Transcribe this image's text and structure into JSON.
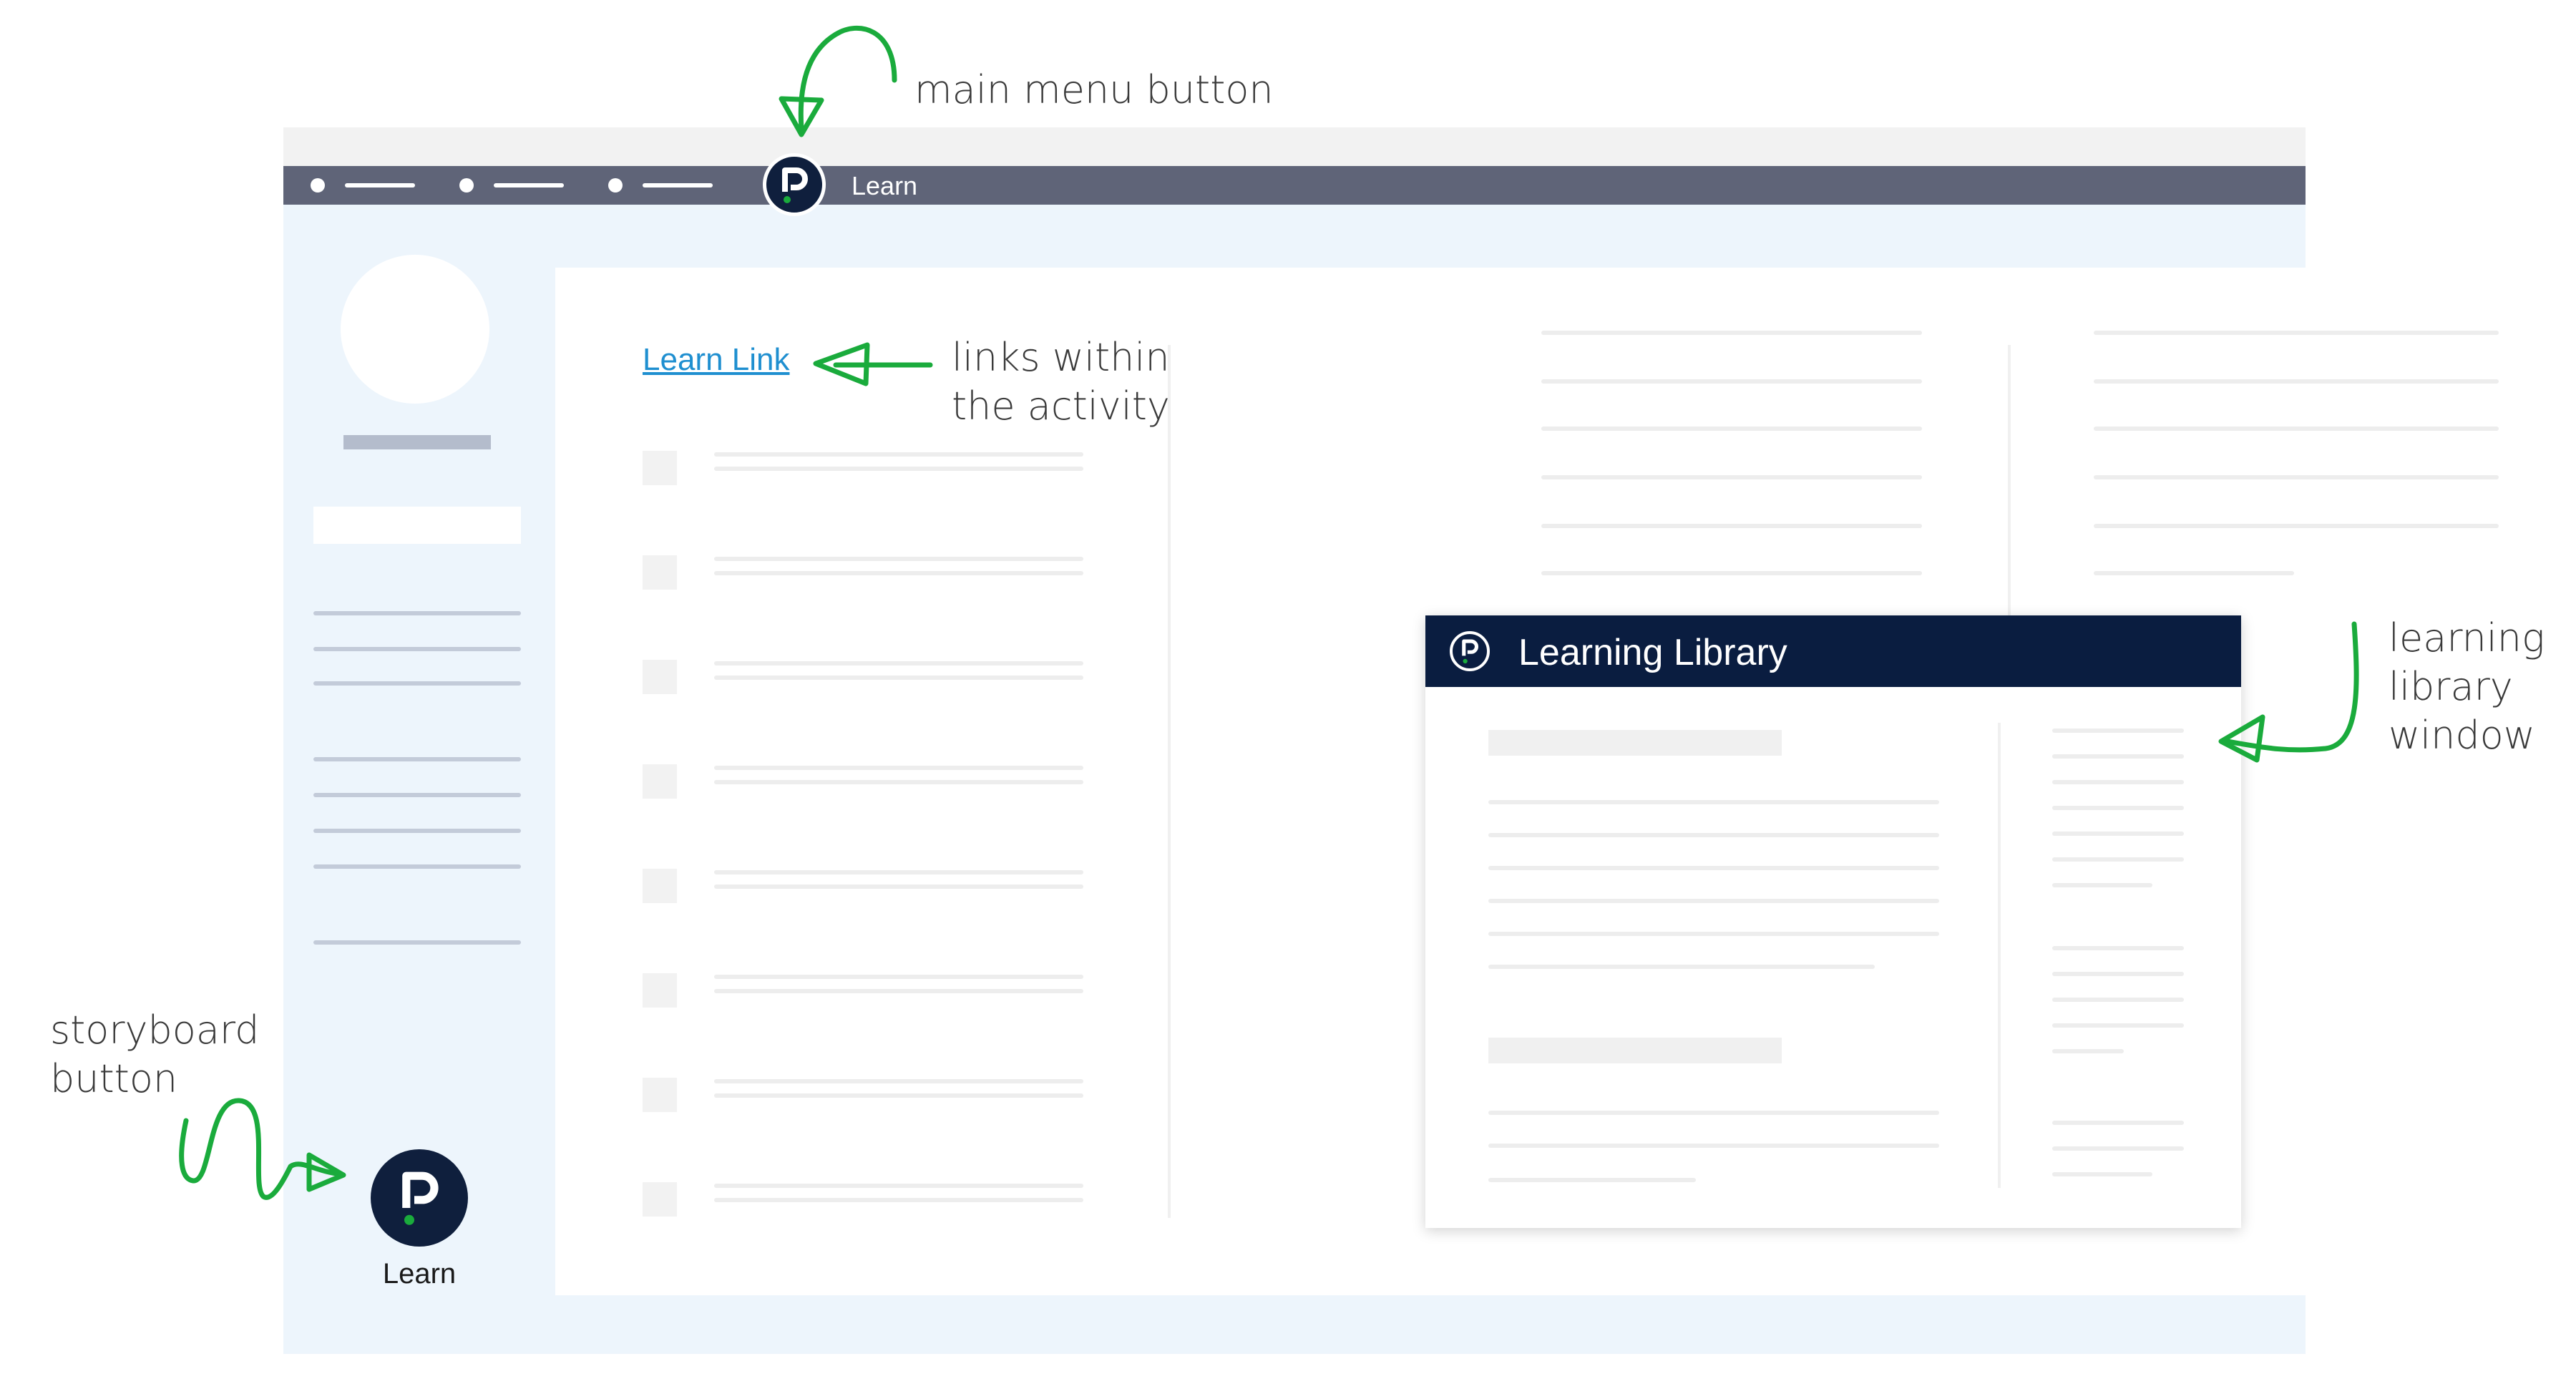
{
  "annotations": {
    "main_menu": "main menu button",
    "links": "links within\nthe activity",
    "library": "learning\nlibrary\nwindow",
    "storyboard": "storyboard\nbutton"
  },
  "menubar": {
    "label": "Learn",
    "logo_icon": "question-logo-icon"
  },
  "sidebar": {
    "storyboard_label": "Learn",
    "storyboard_icon": "question-logo-icon"
  },
  "content": {
    "link_text": "Learn Link"
  },
  "library_window": {
    "title": "Learning Library",
    "logo_icon": "question-logo-icon"
  },
  "colors": {
    "annotation_green": "#1aab3c",
    "menubar": "#5f6478",
    "brand_navy": "#0f1f3d",
    "library_header": "#0a1d40",
    "link": "#1f8fd0",
    "app_background": "#edf5fc"
  }
}
